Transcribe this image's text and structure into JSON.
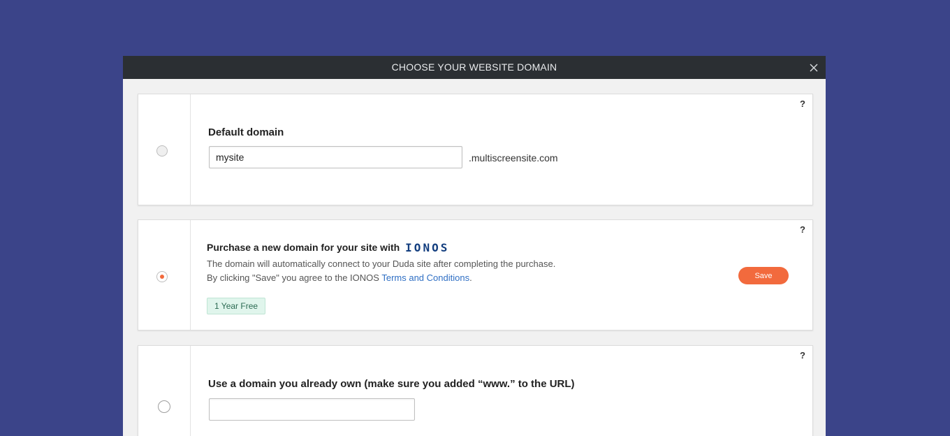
{
  "dialog": {
    "title": "CHOOSE YOUR WEBSITE DOMAIN",
    "close_icon": "close-icon"
  },
  "default_domain": {
    "heading": "Default domain",
    "input_value": "mysite",
    "suffix": ".multiscreensite.com",
    "help": "?",
    "selected": false
  },
  "purchase_domain": {
    "heading": "Purchase a new domain for your site with",
    "logo_text": "IONOS",
    "line1": "The domain will automatically connect to your Duda site after completing the purchase.",
    "line2_prefix": "By clicking \"Save\" you agree to the IONOS ",
    "terms_link": "Terms and Conditions",
    "line2_suffix": ".",
    "badge": "1 Year Free",
    "save_label": "Save",
    "help": "?",
    "selected": true
  },
  "own_domain": {
    "heading": "Use a domain you already own (make sure you added “www.” to the URL)",
    "input_value": "",
    "help": "?",
    "selected": false
  },
  "colors": {
    "background": "#3b4489",
    "titlebar": "#2b2f33",
    "accent": "#f26a3d",
    "link": "#2f6fc4",
    "badge_bg": "#e0f5ec",
    "logo": "#133e7f"
  }
}
